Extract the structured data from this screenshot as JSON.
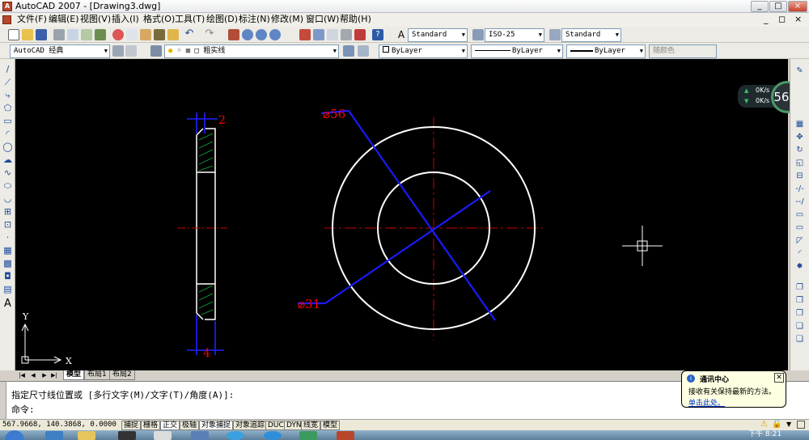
{
  "window": {
    "title": "AutoCAD 2007 - [Drawing3.dwg]",
    "app_icon": "A",
    "minimize": "_",
    "maximize": "□",
    "close": "×",
    "doc_min": "_",
    "doc_restore": "◻",
    "doc_close": "×"
  },
  "menu": [
    "文件(F)",
    "编辑(E)",
    "视图(V)",
    "插入(I)",
    "格式(O)",
    "工具(T)",
    "绘图(D)",
    "标注(N)",
    "修改(M)",
    "窗口(W)",
    "帮助(H)"
  ],
  "toolbar": {
    "text_style": "Standard",
    "dim_style": "ISO-25",
    "table_style": "Standard",
    "workspace": "AutoCAD 经典",
    "layer": "粗实线",
    "color": "ByLayer",
    "linetype": "ByLayer",
    "lineweight": "ByLayer",
    "plot_style": "随颜色"
  },
  "drawing": {
    "dims": {
      "thick_top": "2",
      "thick_bottom": "4",
      "outer_dia": "⌀56",
      "inner_dia": "⌀31"
    },
    "ucs_x": "X",
    "ucs_y": "Y"
  },
  "tabs": {
    "model": "模型",
    "layout1": "布局1",
    "layout2": "布局2",
    "nav": [
      "|◀",
      "◀",
      "▶",
      "▶|"
    ]
  },
  "command": {
    "history": "指定尺寸线位置或 [多行文字(M)/文字(T)/角度(A)]:",
    "prompt": "命令:"
  },
  "status": {
    "coords": "567.9668, 140.3868, 0.0000",
    "buttons": [
      "捕捉",
      "栅格",
      "正交",
      "极轴",
      "对象捕捉",
      "对象追踪",
      "DUCS",
      "DYN",
      "线宽",
      "模型"
    ]
  },
  "balloon": {
    "title": "通讯中心",
    "body": "接收有关保持最新的方法。",
    "link": "单击此处。"
  },
  "net": {
    "up": "0K/s",
    "down": "0K/s",
    "gauge": "56%"
  },
  "taskbar": {
    "time": "下午 8:21"
  },
  "colors": {
    "canvas": "#000000",
    "white": "#ffffff",
    "blue": "#0000ff",
    "red": "#ff0000",
    "center": "#cc0000"
  }
}
